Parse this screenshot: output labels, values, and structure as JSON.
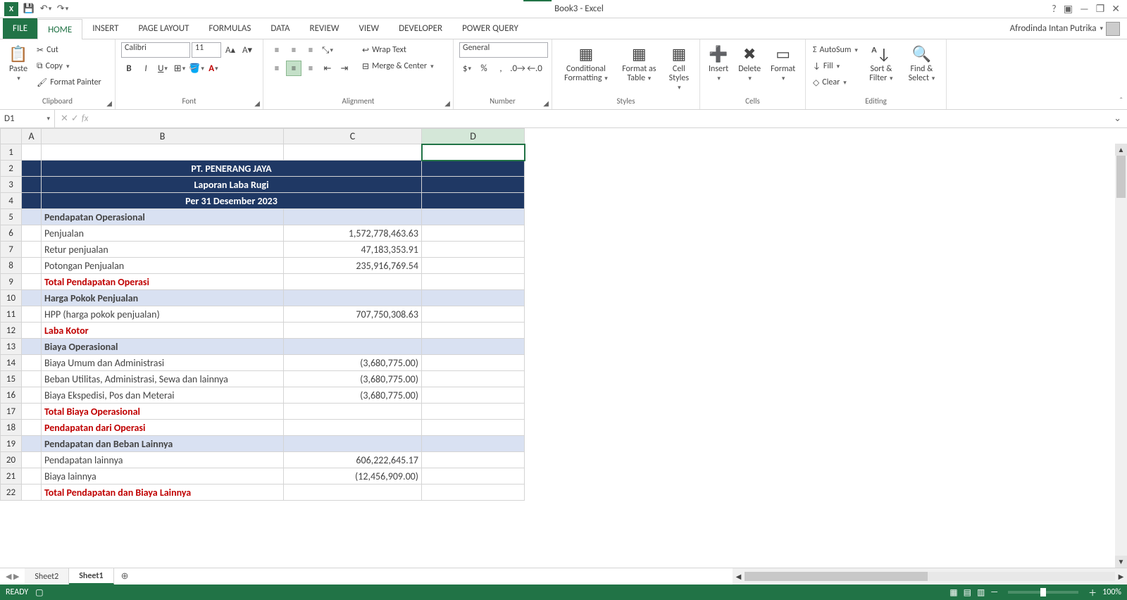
{
  "title": "Book3 - Excel",
  "user_name": "Afrodinda Intan Putrika",
  "tabs": [
    "FILE",
    "HOME",
    "INSERT",
    "PAGE LAYOUT",
    "FORMULAS",
    "DATA",
    "REVIEW",
    "VIEW",
    "DEVELOPER",
    "POWER QUERY"
  ],
  "active_tab": "HOME",
  "clipboard": {
    "paste": "Paste",
    "cut": "Cut",
    "copy": "Copy",
    "format_painter": "Format Painter",
    "label": "Clipboard"
  },
  "font": {
    "name": "Calibri",
    "size": "11",
    "label": "Font"
  },
  "alignment": {
    "wrap": "Wrap Text",
    "merge": "Merge & Center",
    "label": "Alignment"
  },
  "number": {
    "format": "General",
    "label": "Number"
  },
  "styles": {
    "cond": "Conditional Formatting",
    "table": "Format as Table",
    "cell": "Cell Styles",
    "label": "Styles"
  },
  "cells": {
    "insert": "Insert",
    "delete": "Delete",
    "format": "Format",
    "label": "Cells"
  },
  "editing": {
    "autosum": "AutoSum",
    "fill": "Fill",
    "clear": "Clear",
    "sort": "Sort & Filter",
    "find": "Find & Select",
    "label": "Editing"
  },
  "name_box": "D1",
  "formula": "",
  "columns": [
    "A",
    "B",
    "C",
    "D"
  ],
  "rows": [
    {
      "n": 1,
      "cells": [
        "",
        "",
        "",
        ""
      ],
      "type": "blank",
      "selected_col": 3
    },
    {
      "n": 2,
      "cells": [
        "",
        "PT. PENERANG JAYA",
        "",
        ""
      ],
      "type": "title"
    },
    {
      "n": 3,
      "cells": [
        "",
        "Laporan Laba Rugi",
        "",
        ""
      ],
      "type": "title"
    },
    {
      "n": 4,
      "cells": [
        "",
        "Per 31 Desember 2023",
        "",
        ""
      ],
      "type": "title"
    },
    {
      "n": 5,
      "cells": [
        "",
        "Pendapatan Operasional",
        "",
        ""
      ],
      "type": "section"
    },
    {
      "n": 6,
      "cells": [
        "",
        "Penjualan",
        "1,572,778,463.63",
        ""
      ],
      "type": "data"
    },
    {
      "n": 7,
      "cells": [
        "",
        "Retur penjualan",
        "47,183,353.91",
        ""
      ],
      "type": "data"
    },
    {
      "n": 8,
      "cells": [
        "",
        "Potongan Penjualan",
        "235,916,769.54",
        ""
      ],
      "type": "data"
    },
    {
      "n": 9,
      "cells": [
        "",
        "Total Pendapatan Operasi",
        "",
        ""
      ],
      "type": "total",
      "top_border_c": true
    },
    {
      "n": 10,
      "cells": [
        "",
        "Harga Pokok Penjualan",
        "",
        ""
      ],
      "type": "section"
    },
    {
      "n": 11,
      "cells": [
        "",
        "HPP (harga pokok penjualan)",
        "707,750,308.63",
        ""
      ],
      "type": "data"
    },
    {
      "n": 12,
      "cells": [
        "",
        "Laba Kotor",
        "",
        ""
      ],
      "type": "total",
      "top_border_c": true
    },
    {
      "n": 13,
      "cells": [
        "",
        "Biaya Operasional",
        "",
        ""
      ],
      "type": "section"
    },
    {
      "n": 14,
      "cells": [
        "",
        "Biaya Umum dan Administrasi",
        "(3,680,775.00)",
        ""
      ],
      "type": "data"
    },
    {
      "n": 15,
      "cells": [
        "",
        "Beban Utilitas, Administrasi, Sewa dan lainnya",
        "(3,680,775.00)",
        ""
      ],
      "type": "data"
    },
    {
      "n": 16,
      "cells": [
        "",
        "Biaya Ekspedisi, Pos dan Meterai",
        "(3,680,775.00)",
        ""
      ],
      "type": "data"
    },
    {
      "n": 17,
      "cells": [
        "",
        "Total Biaya Operasional",
        "",
        ""
      ],
      "type": "total",
      "top_border_c": true
    },
    {
      "n": 18,
      "cells": [
        "",
        "Pendapatan dari Operasi",
        "",
        ""
      ],
      "type": "total"
    },
    {
      "n": 19,
      "cells": [
        "",
        "Pendapatan dan Beban Lainnya",
        "",
        ""
      ],
      "type": "section"
    },
    {
      "n": 20,
      "cells": [
        "",
        "Pendapatan lainnya",
        "606,222,645.17",
        ""
      ],
      "type": "data"
    },
    {
      "n": 21,
      "cells": [
        "",
        "Biaya lainnya",
        "(12,456,909.00)",
        ""
      ],
      "type": "data"
    },
    {
      "n": 22,
      "cells": [
        "",
        "Total Pendapatan dan Biaya Lainnya",
        "",
        ""
      ],
      "type": "total",
      "cut": true
    }
  ],
  "sheets": [
    "Sheet2",
    "Sheet1"
  ],
  "active_sheet": "Sheet1",
  "status": "READY",
  "zoom": "100%"
}
